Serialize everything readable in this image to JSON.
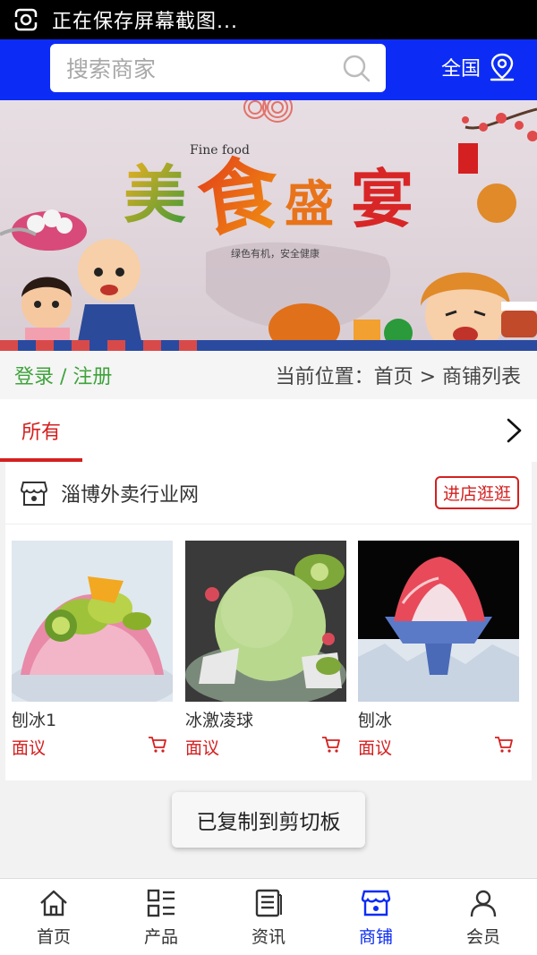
{
  "status_bar": {
    "text": "正在保存屏幕截图..."
  },
  "header": {
    "search_placeholder": "搜索商家",
    "region_label": "全国"
  },
  "banner": {
    "title": "美食盛宴",
    "subtitle": "Fine food",
    "slogan": "绿色有机，安全健康"
  },
  "crumb_row": {
    "login": "登录",
    "separator": " / ",
    "register": "注册",
    "breadcrumb": "当前位置：首页 > 商铺列表"
  },
  "tabs": {
    "all": "所有"
  },
  "shop": {
    "name": "淄博外卖行业网",
    "visit_label": "进店逛逛",
    "products": [
      {
        "name": "刨冰1",
        "price": "面议"
      },
      {
        "name": "冰激凌球",
        "price": "面议"
      },
      {
        "name": "刨冰",
        "price": "面议"
      }
    ]
  },
  "toast": "已复制到剪切板",
  "bottom_nav": [
    {
      "label": "首页",
      "icon": "home-icon"
    },
    {
      "label": "产品",
      "icon": "grid-icon"
    },
    {
      "label": "资讯",
      "icon": "news-icon"
    },
    {
      "label": "商铺",
      "icon": "store-icon",
      "active": true
    },
    {
      "label": "会员",
      "icon": "user-icon"
    }
  ],
  "colors": {
    "brand_blue": "#0c2cf5",
    "accent_red": "#d42020",
    "login_green": "#3fa33b"
  }
}
